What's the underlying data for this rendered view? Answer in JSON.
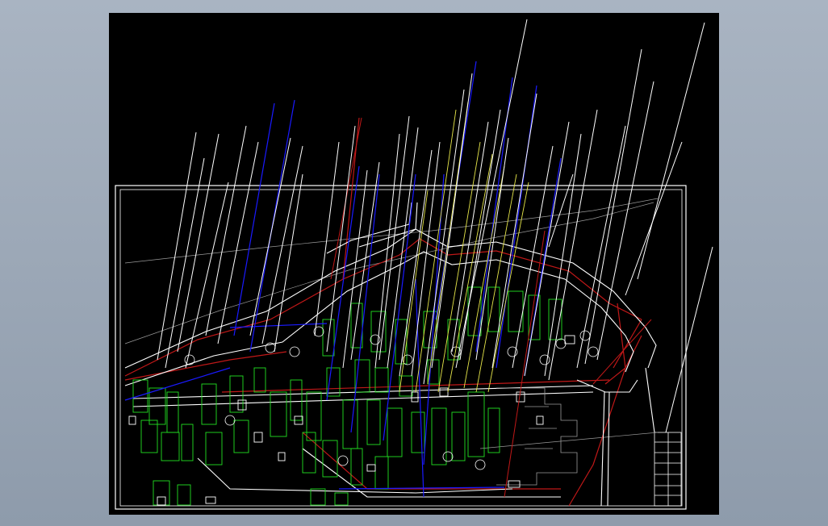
{
  "viewer": {
    "background_color": "#000000",
    "frame_color": "#a9b4c2"
  },
  "drawing": {
    "layer_colors": {
      "border": "#ffffff",
      "leader": "#ffffff",
      "pipe_blue": "#1a1aff",
      "road_red": "#c01818",
      "building_green": "#22e022",
      "leader_yellow": "#e6e64a",
      "ground_gray": "#9a9a9a"
    }
  }
}
